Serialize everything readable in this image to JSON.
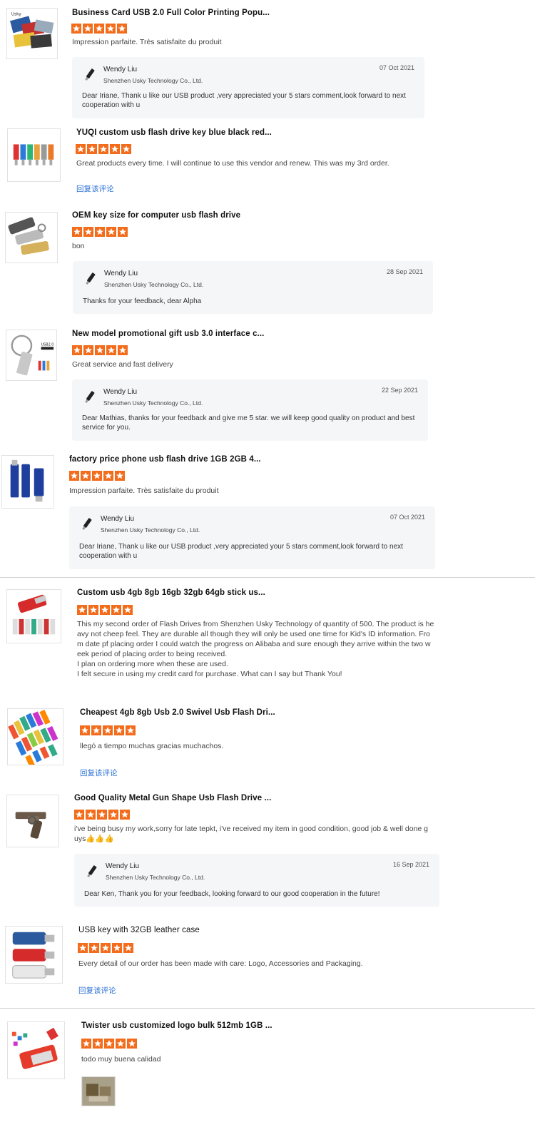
{
  "colors": {
    "star": "#f26c1c",
    "link": "#2a6fd6",
    "reply_bg": "#f5f6f8"
  },
  "reviews": [
    {
      "title": "Business Card USB 2.0 Full Color Printing Popu...",
      "rating": 5,
      "comment": "Impression parfaite. Très satisfaite du produit",
      "thumb_icon": "business-card-usb-icon",
      "reply": {
        "name": "Wendy Liu",
        "company": "Shenzhen Usky Technology Co., Ltd.",
        "date": "07 Oct 2021",
        "text": "Dear Iriane, Thank u like our USB product ,very appreciated your 5 stars comment,look forward to next cooperation with u"
      }
    },
    {
      "title": "YUQI custom usb flash drive key blue black red...",
      "rating": 5,
      "comment": "Great products every time. I will continue to use this vendor and renew. This was my 3rd order.",
      "thumb_icon": "key-usb-icon",
      "reply_link": "回复该评论"
    },
    {
      "title": "OEM key size for computer usb flash drive",
      "rating": 5,
      "comment": "bon",
      "thumb_icon": "metal-usb-icon",
      "reply": {
        "name": "Wendy Liu",
        "company": "Shenzhen Usky Technology Co., Ltd.",
        "date": "28 Sep 2021",
        "text": "Thanks for your feedback, dear Alpha"
      }
    },
    {
      "title": "New model promotional gift usb 3.0 interface c...",
      "rating": 5,
      "comment": "Great service and fast delivery",
      "thumb_icon": "keyring-usb-icon",
      "reply": {
        "name": "Wendy Liu",
        "company": "Shenzhen Usky Technology Co., Ltd.",
        "date": "22 Sep 2021",
        "text": "Dear Mathias, thanks for your feedback and give me 5 star. we will keep good quality on product and best service for you."
      }
    },
    {
      "title": "factory price phone usb flash drive 1GB 2GB 4...",
      "rating": 5,
      "comment": "Impression parfaite. Très satisfaite du produit",
      "thumb_icon": "phone-usb-icon",
      "reply": {
        "name": "Wendy Liu",
        "company": "Shenzhen Usky Technology Co., Ltd.",
        "date": "07 Oct 2021",
        "text": "Dear Iriane, Thank u like our USB product ,very appreciated your 5 stars comment,look forward to next cooperation with u"
      }
    },
    {
      "title": "Custom usb 4gb 8gb 16gb 32gb 64gb stick us...",
      "rating": 5,
      "comment": "This my second order of Flash Drives from Shenzhen Usky Technology of quantity of 500. The product is he avy not cheep feel. They are durable all though they will only be used one time for Kid's ID information. Fro m date pf placing order I could watch the progress on Alibaba and sure enough they arrive within the two w eek period of placing order to being received.\nI plan on ordering more when these are used.\nI felt secure in using my credit card for purchase. What can I say but Thank You!",
      "thumb_icon": "swivel-usb-icon"
    },
    {
      "title": "Cheapest 4gb 8gb Usb 2.0 Swivel Usb Flash Dri...",
      "rating": 5,
      "comment": "llegó a tiempo muchas gracias muchachos.",
      "thumb_icon": "colorful-swivel-usb-icon",
      "reply_link": "回复该评论"
    },
    {
      "title": "Good Quality Metal Gun Shape Usb Flash Drive ...",
      "rating": 5,
      "comment": "i've being busy my work,sorry for late tepkt, i've received my item in good condition, good job & well done g uys👍👍👍",
      "thumb_icon": "gun-usb-icon",
      "reply": {
        "name": "Wendy Liu",
        "company": "Shenzhen Usky Technology Co., Ltd.",
        "date": "16 Sep 2021",
        "text": "Dear Ken, Thank you for your feedback, looking forward to our good cooperation in the future!"
      }
    },
    {
      "title": "USB key with 32GB leather case",
      "rating": 5,
      "comment": "Every detail of our order has been made with care: Logo, Accessories and Packaging.",
      "thumb_icon": "leather-usb-icon",
      "reply_link": "回复该评论"
    },
    {
      "title": "Twister usb customized logo bulk 512mb 1GB ...",
      "rating": 5,
      "comment": "todo muy buena calidad",
      "thumb_icon": "twister-usb-icon",
      "photo_icon": "review-photo-icon"
    }
  ]
}
